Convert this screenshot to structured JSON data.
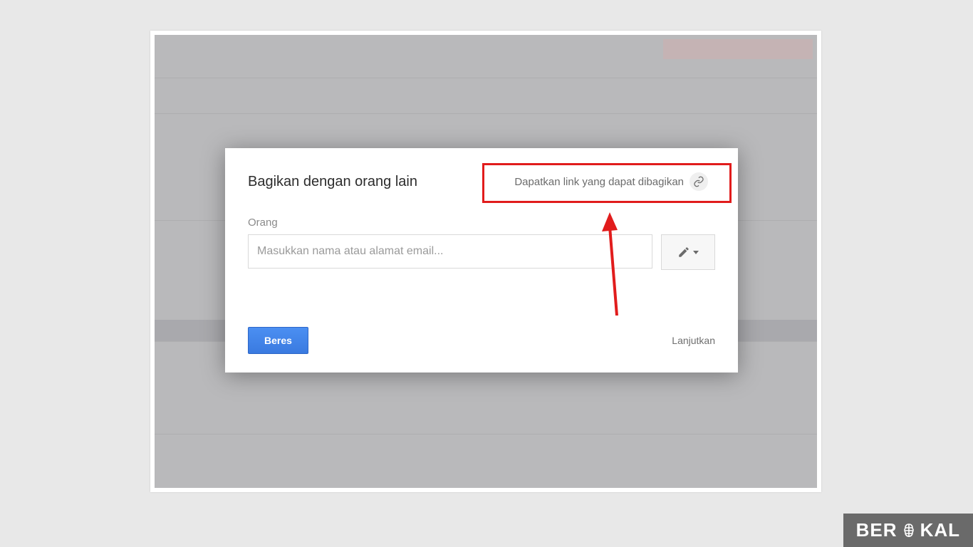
{
  "dialog": {
    "title": "Bagikan dengan orang lain",
    "get_link_label": "Dapatkan link yang dapat dibagikan",
    "people_label": "Orang",
    "email_placeholder": "Masukkan nama atau alamat email...",
    "done_label": "Beres",
    "advanced_label": "Lanjutkan"
  },
  "icons": {
    "link": "link-icon",
    "pencil": "pencil-icon",
    "caret": "chevron-down-icon"
  },
  "annotation": {
    "highlight_target": "get-shareable-link-button"
  },
  "watermark": {
    "text_left": "BER",
    "text_right": "KAL"
  }
}
